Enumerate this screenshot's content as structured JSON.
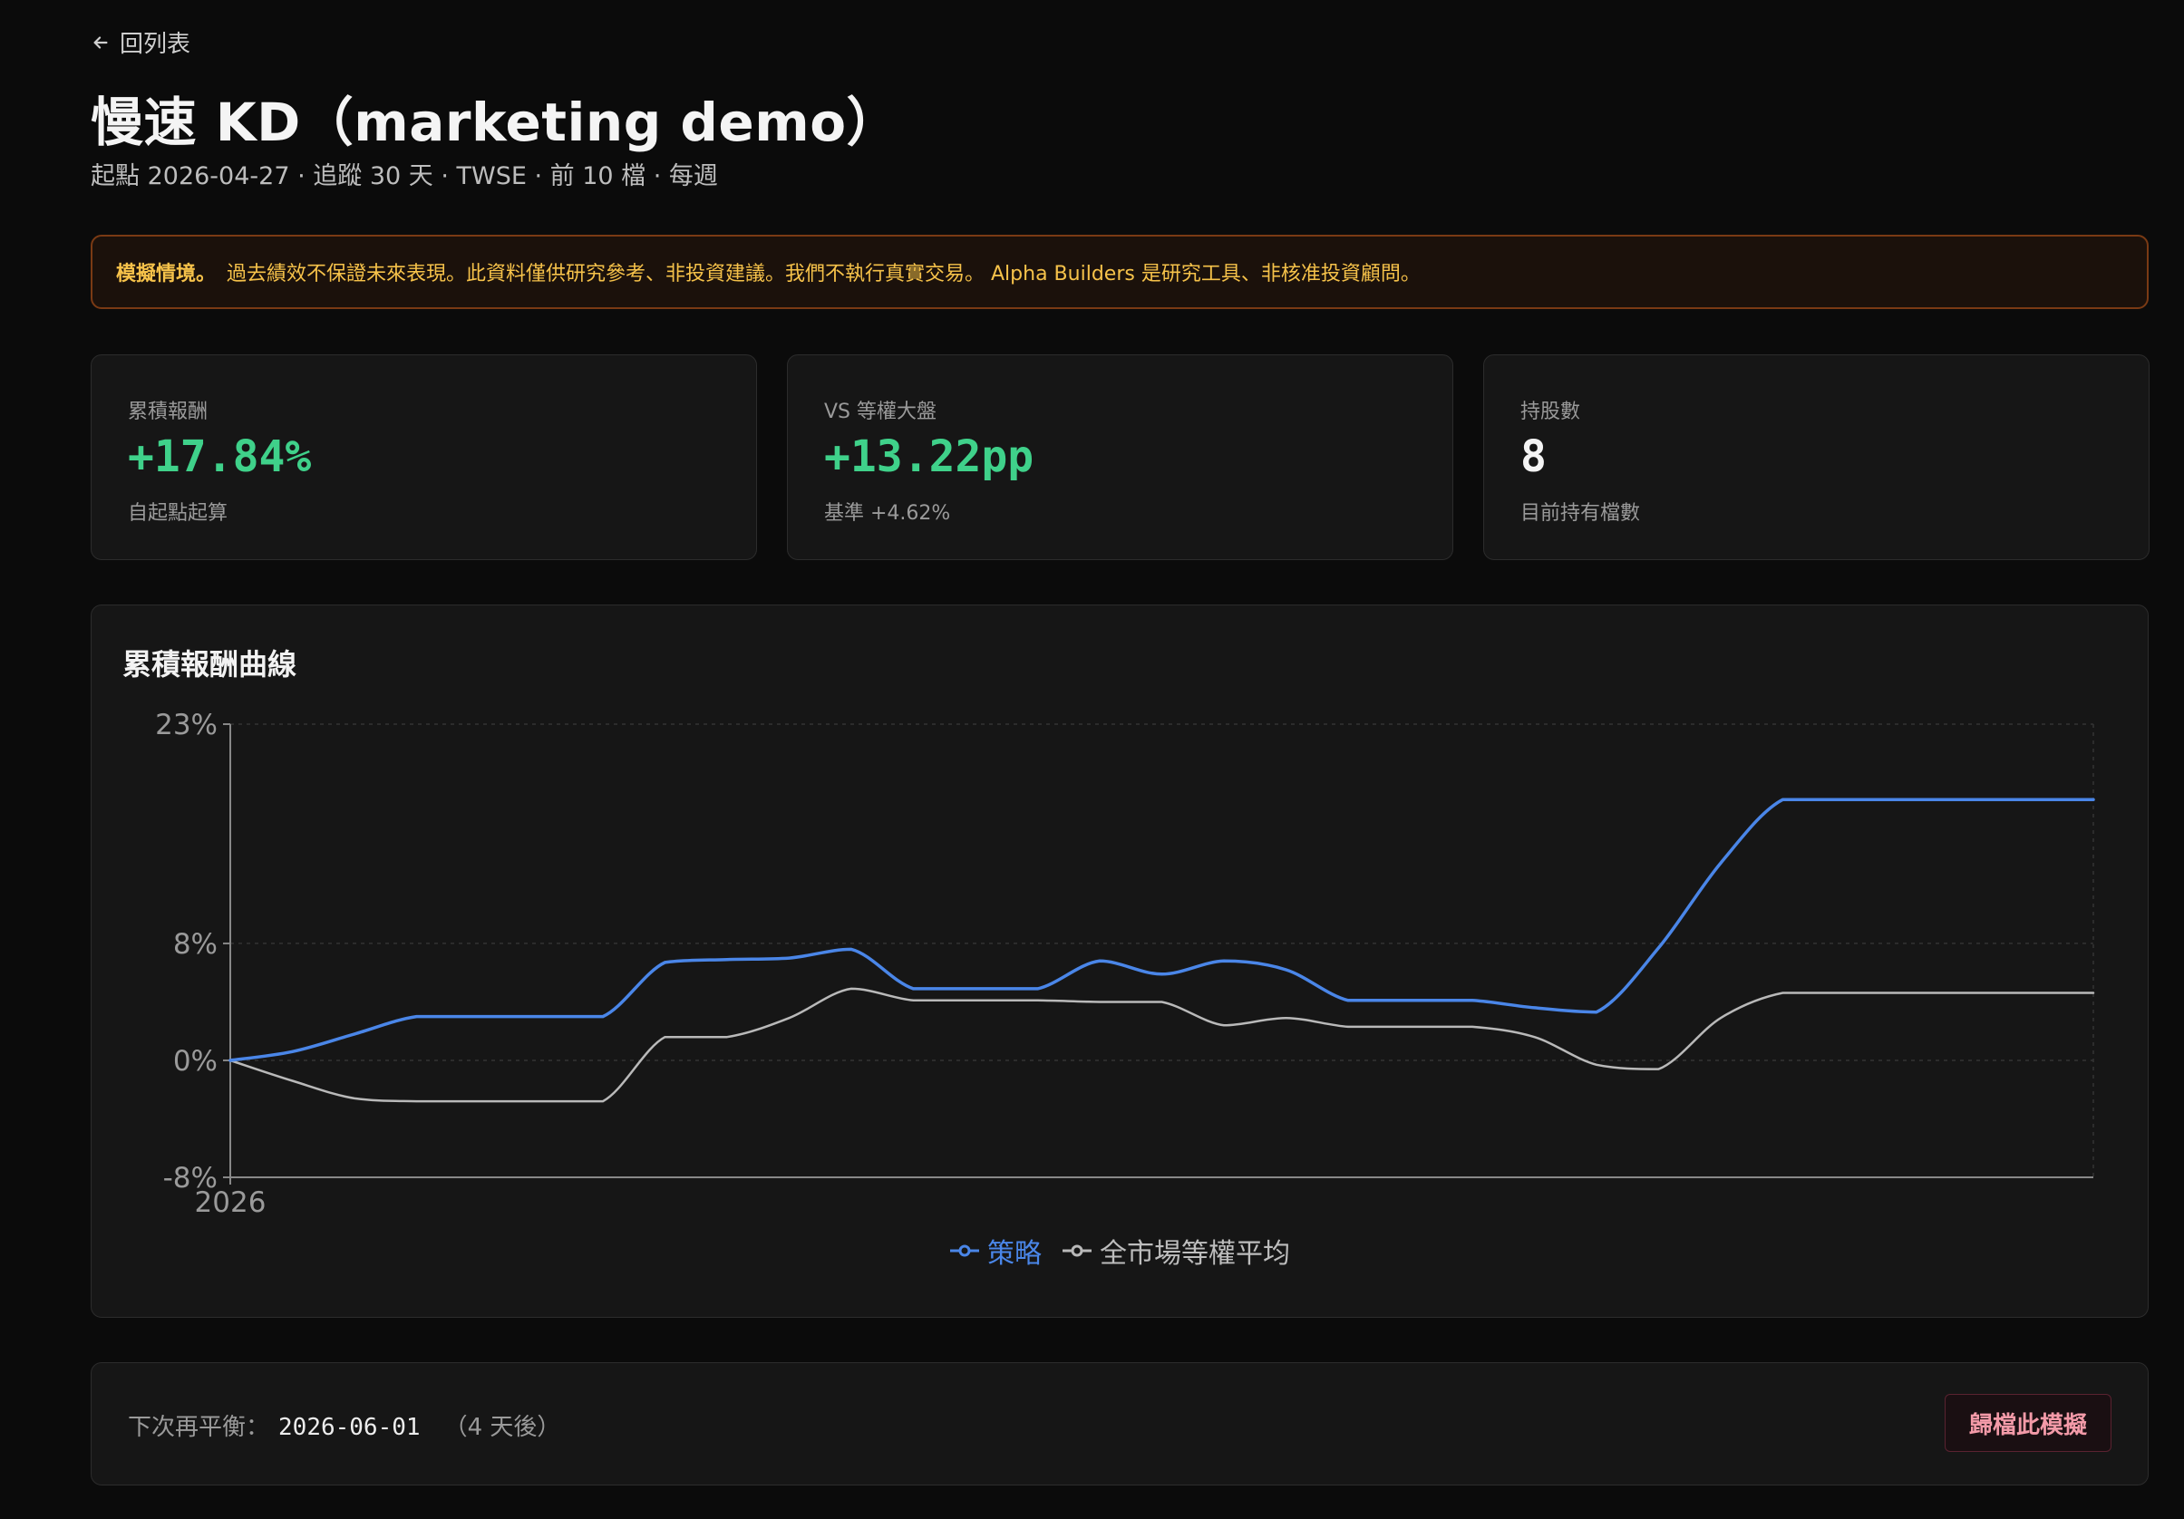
{
  "nav": {
    "back_label": "回列表"
  },
  "header": {
    "title": "慢速 KD（marketing demo）",
    "subtitle": "起點 2026-04-27 · 追蹤 30 天 · TWSE · 前 10 檔 · 每週"
  },
  "notice": {
    "lead": "模擬情境。",
    "text": "過去績效不保證未來表現。此資料僅供研究參考、非投資建議。我們不執行真實交易。 Alpha Builders 是研究工具、非核准投資顧問。"
  },
  "cards": [
    {
      "label": "累積報酬",
      "value": "+17.84%",
      "sub": "自起點起算",
      "value_color": "#3fd18a"
    },
    {
      "label": "VS 等權大盤",
      "value": "+13.22pp",
      "sub": "基準 +4.62%",
      "value_color": "#3fd18a"
    },
    {
      "label": "持股數",
      "value": "8",
      "sub": "目前持有檔數",
      "value_color": "#f4f4f4"
    }
  ],
  "chart": {
    "title": "累積報酬曲線"
  },
  "chart_data": {
    "type": "line",
    "title": "累積報酬曲線",
    "ylim": [
      -8,
      23
    ],
    "y_ticks": [
      "23%",
      "8%",
      "0%",
      "-8%"
    ],
    "y_tick_values": [
      23,
      8,
      0,
      -8
    ],
    "x_tick_label": "2026",
    "x": [
      0,
      1,
      2,
      3,
      4,
      5,
      6,
      7,
      8,
      9,
      10,
      11,
      12,
      13,
      14,
      15,
      16,
      17,
      18,
      19,
      20,
      21,
      22,
      23,
      24,
      25,
      26,
      27,
      28,
      29,
      30
    ],
    "series": [
      {
        "name": "策略",
        "color": "#4a86e8",
        "values": [
          0,
          0.6,
          1.8,
          3.0,
          3.0,
          3.0,
          3.0,
          6.7,
          6.9,
          7.0,
          7.6,
          4.9,
          4.9,
          4.9,
          6.8,
          5.9,
          6.8,
          6.2,
          4.1,
          4.1,
          4.1,
          3.6,
          3.3,
          7.7,
          13.5,
          17.84,
          17.84,
          17.84,
          17.84,
          17.84,
          17.84
        ]
      },
      {
        "name": "全市場等權平均",
        "color": "#b9b9b9",
        "values": [
          0,
          -1.4,
          -2.6,
          -2.8,
          -2.8,
          -2.8,
          -2.8,
          1.6,
          1.6,
          2.9,
          4.9,
          4.1,
          4.1,
          4.1,
          4.0,
          4.0,
          2.4,
          2.9,
          2.3,
          2.3,
          2.3,
          1.6,
          -0.3,
          -0.6,
          2.9,
          4.62,
          4.62,
          4.62,
          4.62,
          4.62,
          4.62
        ]
      }
    ],
    "grid": true,
    "legend_position": "bottom-center"
  },
  "footer": {
    "next_label": "下次再平衡：",
    "next_date": "2026-06-01",
    "days_label": "（4 天後）",
    "archive_label": "歸檔此模擬"
  }
}
